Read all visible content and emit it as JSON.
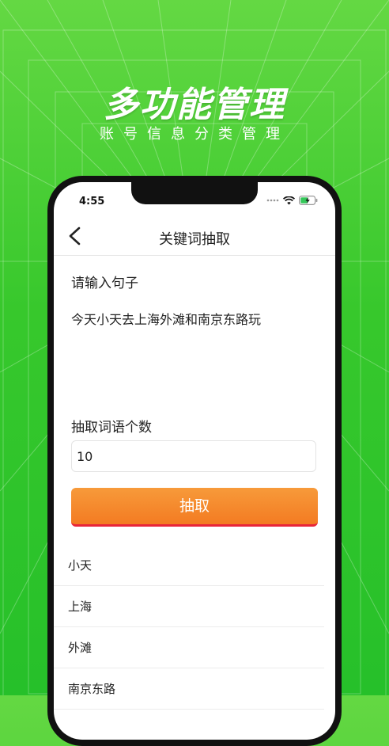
{
  "promo": {
    "title": "多功能管理",
    "subtitle": "账号信息分类管理"
  },
  "status_bar": {
    "time": "4:55",
    "icons": [
      "signal-dots-icon",
      "wifi-icon",
      "battery-charging-icon"
    ]
  },
  "nav": {
    "back_icon": "chevron-left-icon",
    "title": "关键词抽取"
  },
  "form": {
    "sentence_label": "请输入句子",
    "sentence_value": "今天小天去上海外滩和南京东路玩",
    "count_label": "抽取词语个数",
    "count_value": "10",
    "extract_button": "抽取"
  },
  "results": [
    "小天",
    "上海",
    "外滩",
    "南京东路"
  ],
  "colors": {
    "background_green": "#37c82c",
    "button_orange": "#f37b22",
    "button_underline": "#e8253a"
  }
}
